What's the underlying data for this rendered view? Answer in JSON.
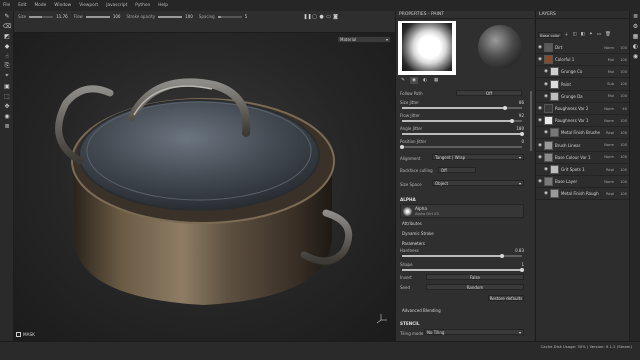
{
  "menu": [
    "File",
    "Edit",
    "Mode",
    "Window",
    "Viewport",
    "Javascript",
    "Python",
    "Help"
  ],
  "toolbar": {
    "size_label": "Size",
    "size_value": "11.76",
    "size_fill": 0.55,
    "flow_label": "Flow",
    "flow_value": "100",
    "flow_fill": 1.0,
    "stroke_opacity_label": "Stroke opacity",
    "stroke_opacity_value": "100",
    "stroke_opacity_fill": 1.0,
    "spacing_label": "Spacing",
    "spacing_value": "5",
    "spacing_fill": 0.15
  },
  "viewport": {
    "material_select": "Material",
    "mask_label": "MASK"
  },
  "properties": {
    "title": "PROPERTIES - PAINT",
    "follow_path_label": "Follow Path",
    "follow_path_value": "Off",
    "size_jitter_label": "Size Jitter",
    "size_jitter_value": "86",
    "size_jitter_fill": 0.86,
    "flow_jitter_label": "Flow Jitter",
    "flow_jitter_value": "92",
    "flow_jitter_fill": 0.92,
    "angle_jitter_label": "Angle Jitter",
    "angle_jitter_value": "180",
    "angle_jitter_fill": 1.0,
    "position_jitter_label": "Position Jitter",
    "position_jitter_value": "0",
    "position_jitter_fill": 0.0,
    "alignment_label": "Alignment",
    "alignment_value": "Tangent | Wrap",
    "backface_label": "Backface culling",
    "backface_value": "Off",
    "size_space_label": "Size Space",
    "size_space_value": "Object",
    "alpha_section": "ALPHA",
    "alpha_name": "Alpha",
    "alpha_sub": "Alpha Dirt 03",
    "attributes_label": "Attributes",
    "dynamic_stroke_label": "Dynamic Stroke",
    "parameters_label": "Parameters",
    "hardness_label": "Hardness",
    "hardness_value": "0.83",
    "hardness_fill": 0.83,
    "shape_label": "Shape",
    "shape_value": "1",
    "shape_fill": 1.0,
    "invert_label": "Invert",
    "invert_value": "False",
    "seed_label": "Seed",
    "seed_value": "Random",
    "restore_label": "Restore defaults",
    "advanced_blending_label": "Advanced Blending",
    "stencil_section": "STENCIL",
    "tiling_label": "Tiling mode",
    "tiling_value": "No Tiling"
  },
  "layers": {
    "title": "LAYERS",
    "channel_select": "Base color",
    "items": [
      {
        "name": "Dirt",
        "blend": "Norm",
        "opacity": "100",
        "thumb": "#5a5a5a"
      },
      {
        "name": "Colorful 1",
        "blend": "Mul",
        "opacity": "100",
        "thumb": "#8a4a2a"
      },
      {
        "name": "Grunge Co",
        "blend": "Mul",
        "opacity": "100",
        "thumb": "#cfcfcf"
      },
      {
        "name": "Paint",
        "blend": "Sub",
        "opacity": "100",
        "thumb": "#dcdcdc"
      },
      {
        "name": "Grunge Da",
        "blend": "Mul",
        "opacity": "100",
        "thumb": "#bdbdbd"
      },
      {
        "name": "Roughness Var 2",
        "blend": "Norm",
        "opacity": "40",
        "thumb": "#3a3a3a"
      },
      {
        "name": "Roughness Var 1",
        "blend": "Norm",
        "opacity": "100",
        "thumb": "#eaeaea"
      },
      {
        "name": "Metal Finish Brushe",
        "blend": "Repl",
        "opacity": "100",
        "thumb": "#777777"
      },
      {
        "name": "Brush Linear",
        "blend": "Norm",
        "opacity": "100",
        "thumb": "#9a9a9a"
      },
      {
        "name": "Base Colour Var 1",
        "blend": "Norm",
        "opacity": "100",
        "thumb": "#8a8a8a"
      },
      {
        "name": "Grit Spots 1",
        "blend": "Repl",
        "opacity": "100",
        "thumb": "#bcbcbc"
      },
      {
        "name": "Base Layer",
        "blend": "Norm",
        "opacity": "100",
        "thumb": "#7a7a7a"
      },
      {
        "name": "Metal Finish Rough",
        "blend": "Repl",
        "opacity": "100",
        "thumb": "#999999"
      }
    ]
  },
  "status": {
    "text": "Cache Disk Usage: 30% | Version: 9.1.2 (Steam)"
  }
}
